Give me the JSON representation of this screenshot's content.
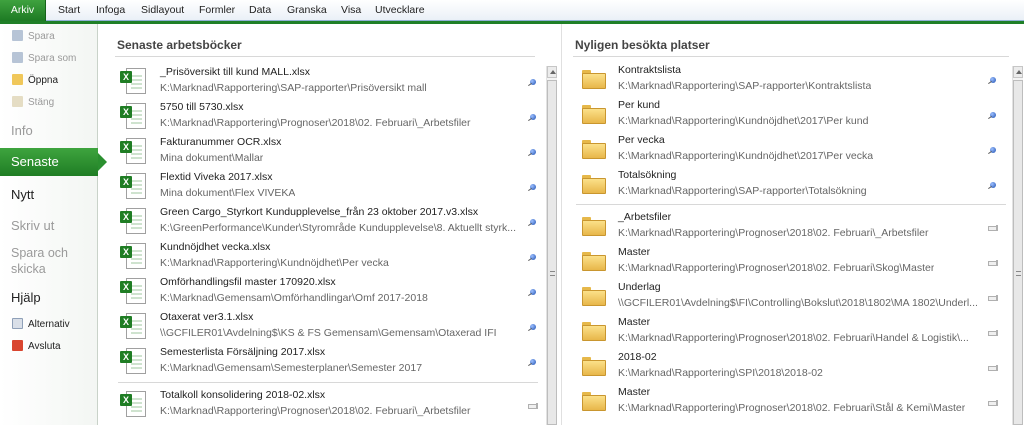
{
  "ribbon": {
    "tabs": [
      "Arkiv",
      "Start",
      "Infoga",
      "Sidlayout",
      "Formler",
      "Data",
      "Granska",
      "Visa",
      "Utvecklare"
    ]
  },
  "sidebar": {
    "spara": "Spara",
    "spara_som": "Spara som",
    "oppna": "Öppna",
    "stang": "Stäng",
    "info": "Info",
    "senaste": "Senaste",
    "nytt": "Nytt",
    "skriv_ut": "Skriv ut",
    "spara_och_skicka": "Spara och skicka",
    "hjalp": "Hjälp",
    "alternativ": "Alternativ",
    "avsluta": "Avsluta"
  },
  "recent_workbooks": {
    "title": "Senaste arbetsböcker",
    "items": [
      {
        "name": "_Prisöversikt till kund MALL.xlsx",
        "path": "K:\\Marknad\\Rapportering\\SAP-rapporter\\Prisöversikt mall",
        "pinned": true
      },
      {
        "name": "5750 till 5730.xlsx",
        "path": "K:\\Marknad\\Rapportering\\Prognoser\\2018\\02. Februari\\_Arbetsfiler",
        "pinned": true
      },
      {
        "name": "Fakturanummer OCR.xlsx",
        "path": "Mina dokument\\Mallar",
        "pinned": true
      },
      {
        "name": "Flextid Viveka 2017.xlsx",
        "path": "Mina dokument\\Flex VIVEKA",
        "pinned": true
      },
      {
        "name": "Green Cargo_Styrkort Kundupplevelse_från 23 oktober 2017.v3.xlsx",
        "path": "K:\\GreenPerformance\\Kunder\\Styrområde Kundupplevelse\\8. Aktuellt styrk...",
        "pinned": true
      },
      {
        "name": "Kundnöjdhet vecka.xlsx",
        "path": "K:\\Marknad\\Rapportering\\Kundnöjdhet\\Per vecka",
        "pinned": true
      },
      {
        "name": "Omförhandlingsfil master 170920.xlsx",
        "path": "K:\\Marknad\\Gemensam\\Omförhandlingar\\Omf 2017-2018",
        "pinned": true
      },
      {
        "name": "Otaxerat ver3.1.xlsx",
        "path": "\\\\GCFILER01\\Avdelning$\\KS & FS Gemensam\\Gemensam\\Otaxerad IFI",
        "pinned": true
      },
      {
        "name": "Semesterlista Försäljning 2017.xlsx",
        "path": "K:\\Marknad\\Gemensam\\Semesterplaner\\Semester 2017",
        "pinned": true
      },
      {
        "name": "Totalkoll konsolidering 2018-02.xlsx",
        "path": "K:\\Marknad\\Rapportering\\Prognoser\\2018\\02. Februari\\_Arbetsfiler",
        "pinned": false
      }
    ]
  },
  "recent_places": {
    "title": "Nyligen besökta platser",
    "items": [
      {
        "name": "Kontraktslista",
        "path": "K:\\Marknad\\Rapportering\\SAP-rapporter\\Kontraktslista",
        "pinned": true
      },
      {
        "name": "Per kund",
        "path": "K:\\Marknad\\Rapportering\\Kundnöjdhet\\2017\\Per kund",
        "pinned": true
      },
      {
        "name": "Per vecka",
        "path": "K:\\Marknad\\Rapportering\\Kundnöjdhet\\2017\\Per vecka",
        "pinned": true
      },
      {
        "name": "Totalsökning",
        "path": "K:\\Marknad\\Rapportering\\SAP-rapporter\\Totalsökning",
        "pinned": true
      },
      {
        "name": "_Arbetsfiler",
        "path": "K:\\Marknad\\Rapportering\\Prognoser\\2018\\02. Februari\\_Arbetsfiler",
        "pinned": false
      },
      {
        "name": "Master",
        "path": "K:\\Marknad\\Rapportering\\Prognoser\\2018\\02. Februari\\Skog\\Master",
        "pinned": false
      },
      {
        "name": "Underlag",
        "path": "\\\\GCFILER01\\Avdelning$\\FI\\Controlling\\Bokslut\\2018\\1802\\MA 1802\\Underl...",
        "pinned": false
      },
      {
        "name": "Master",
        "path": "K:\\Marknad\\Rapportering\\Prognoser\\2018\\02. Februari\\Handel & Logistik\\...",
        "pinned": false
      },
      {
        "name": "2018-02",
        "path": "K:\\Marknad\\Rapportering\\SPI\\2018\\2018-02",
        "pinned": false
      },
      {
        "name": "Master",
        "path": "K:\\Marknad\\Rapportering\\Prognoser\\2018\\02. Februari\\Stål & Kemi\\Master",
        "pinned": false
      }
    ]
  },
  "colors": {
    "accent_green": "#1f7d24",
    "ribbon_border": "#8fb0d6"
  }
}
